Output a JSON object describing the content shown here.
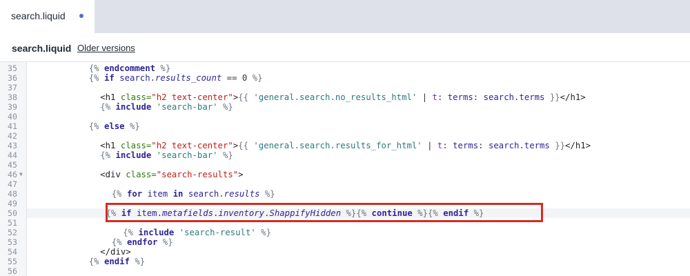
{
  "tab": {
    "label": "search.liquid"
  },
  "header": {
    "title": "search.liquid",
    "older_versions": "Older versions"
  },
  "editor": {
    "lines": [
      {
        "n": "35",
        "indent": 11,
        "tokens": [
          [
            "t-delim",
            "{% "
          ],
          [
            "t-kw",
            "endcomment"
          ],
          [
            "t-delim",
            " %}"
          ]
        ]
      },
      {
        "n": "36",
        "indent": 11,
        "tokens": [
          [
            "t-delim",
            "{% "
          ],
          [
            "t-kw",
            "if"
          ],
          [
            "t-op",
            " "
          ],
          [
            "t-var",
            "search"
          ],
          [
            "t-op",
            "."
          ],
          [
            "t-prop",
            "results_count"
          ],
          [
            "t-op",
            " == 0 "
          ],
          [
            "t-delim",
            "%}"
          ]
        ]
      },
      {
        "n": "37",
        "indent": 0,
        "tokens": []
      },
      {
        "n": "38",
        "indent": 13,
        "tokens": [
          [
            "t-tag",
            "<h1 "
          ],
          [
            "t-attr",
            "class="
          ],
          [
            "t-val",
            "\"h2 text-center\""
          ],
          [
            "t-tag",
            ">"
          ],
          [
            "t-delim",
            "{{ "
          ],
          [
            "t-str",
            "'general.search.no_results_html'"
          ],
          [
            "t-op",
            " | "
          ],
          [
            "t-filter",
            "t"
          ],
          [
            "t-op",
            ": "
          ],
          [
            "t-var",
            "terms"
          ],
          [
            "t-op",
            ": "
          ],
          [
            "t-var",
            "search.terms"
          ],
          [
            "t-delim",
            " }}"
          ],
          [
            "t-tag",
            "</h1>"
          ]
        ]
      },
      {
        "n": "39",
        "indent": 13,
        "tokens": [
          [
            "t-delim",
            "{% "
          ],
          [
            "t-kw",
            "include"
          ],
          [
            "t-op",
            " "
          ],
          [
            "t-str",
            "'search-bar'"
          ],
          [
            "t-delim",
            " %}"
          ]
        ]
      },
      {
        "n": "40",
        "indent": 0,
        "tokens": []
      },
      {
        "n": "41",
        "indent": 11,
        "tokens": [
          [
            "t-delim",
            "{% "
          ],
          [
            "t-kw",
            "else"
          ],
          [
            "t-delim",
            " %}"
          ]
        ]
      },
      {
        "n": "42",
        "indent": 0,
        "tokens": []
      },
      {
        "n": "43",
        "indent": 13,
        "tokens": [
          [
            "t-tag",
            "<h1 "
          ],
          [
            "t-attr",
            "class="
          ],
          [
            "t-val",
            "\"h2 text-center\""
          ],
          [
            "t-tag",
            ">"
          ],
          [
            "t-delim",
            "{{ "
          ],
          [
            "t-str",
            "'general.search.results_for_html'"
          ],
          [
            "t-op",
            " | "
          ],
          [
            "t-filter",
            "t"
          ],
          [
            "t-op",
            ": "
          ],
          [
            "t-var",
            "terms"
          ],
          [
            "t-op",
            ": "
          ],
          [
            "t-var",
            "search.terms"
          ],
          [
            "t-delim",
            " }}"
          ],
          [
            "t-tag",
            "</h1>"
          ]
        ]
      },
      {
        "n": "44",
        "indent": 13,
        "tokens": [
          [
            "t-delim",
            "{% "
          ],
          [
            "t-kw",
            "include"
          ],
          [
            "t-op",
            " "
          ],
          [
            "t-str",
            "'search-bar'"
          ],
          [
            "t-delim",
            " %}"
          ]
        ]
      },
      {
        "n": "45",
        "indent": 0,
        "tokens": []
      },
      {
        "n": "46",
        "indent": 13,
        "fold": true,
        "tokens": [
          [
            "t-tag",
            "<div "
          ],
          [
            "t-attr",
            "class="
          ],
          [
            "t-val",
            "\"search-results\""
          ],
          [
            "t-tag",
            ">"
          ]
        ]
      },
      {
        "n": "47",
        "indent": 0,
        "tokens": []
      },
      {
        "n": "48",
        "indent": 15,
        "tokens": [
          [
            "t-delim",
            "{% "
          ],
          [
            "t-kw",
            "for"
          ],
          [
            "t-op",
            " "
          ],
          [
            "t-var",
            "item"
          ],
          [
            "t-op",
            " "
          ],
          [
            "t-kw",
            "in"
          ],
          [
            "t-op",
            " "
          ],
          [
            "t-var",
            "search"
          ],
          [
            "t-op",
            "."
          ],
          [
            "t-prop",
            "results"
          ],
          [
            "t-delim",
            " %}"
          ]
        ]
      },
      {
        "n": "49",
        "indent": 0,
        "tokens": []
      },
      {
        "n": "50",
        "indent": 14,
        "active": true,
        "tokens": [
          [
            "t-delim",
            "{% "
          ],
          [
            "t-kw",
            "if"
          ],
          [
            "t-op",
            " "
          ],
          [
            "t-var",
            "item"
          ],
          [
            "t-op",
            "."
          ],
          [
            "t-prop",
            "metafields"
          ],
          [
            "t-op",
            "."
          ],
          [
            "t-prop",
            "inventory"
          ],
          [
            "t-op",
            "."
          ],
          [
            "t-prop",
            "ShappifyHidden"
          ],
          [
            "t-delim",
            " %}{% "
          ],
          [
            "t-kw",
            "continue"
          ],
          [
            "t-delim",
            " %}{% "
          ],
          [
            "t-kw",
            "endif"
          ],
          [
            "t-delim",
            " %}"
          ]
        ]
      },
      {
        "n": "51",
        "indent": 0,
        "tokens": []
      },
      {
        "n": "52",
        "indent": 17,
        "tokens": [
          [
            "t-delim",
            "{% "
          ],
          [
            "t-kw",
            "include"
          ],
          [
            "t-op",
            " "
          ],
          [
            "t-str",
            "'search-result'"
          ],
          [
            "t-delim",
            " %}"
          ]
        ]
      },
      {
        "n": "53",
        "indent": 15,
        "tokens": [
          [
            "t-delim",
            "{% "
          ],
          [
            "t-kw",
            "endfor"
          ],
          [
            "t-delim",
            " %}"
          ]
        ]
      },
      {
        "n": "54",
        "indent": 13,
        "tokens": [
          [
            "t-tag",
            "</div>"
          ]
        ]
      },
      {
        "n": "55",
        "indent": 11,
        "tokens": [
          [
            "t-delim",
            "{% "
          ],
          [
            "t-kw",
            "endif"
          ],
          [
            "t-delim",
            " %}"
          ]
        ]
      },
      {
        "n": "56",
        "indent": 0,
        "tokens": []
      }
    ]
  },
  "colors": {
    "highlight_border": "#d62b1f",
    "tab_dot": "#5c6ac4"
  }
}
